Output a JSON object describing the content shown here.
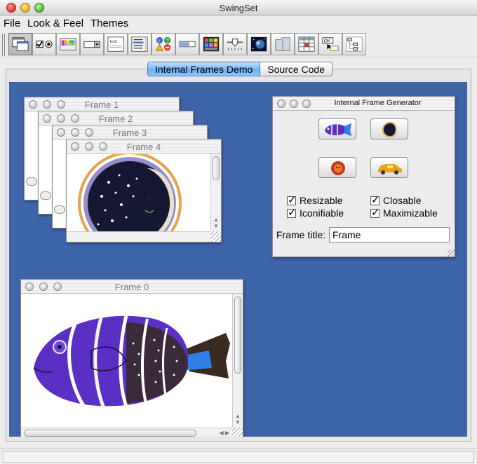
{
  "window": {
    "title": "SwingSet"
  },
  "menubar": {
    "items": [
      "File",
      "Look & Feel",
      "Themes"
    ]
  },
  "toolbar": {
    "buttons": [
      "internal-frames-icon",
      "checkbox-radio-icon",
      "color-chooser-icon",
      "combobox-icon",
      "editor-pane-icon",
      "list-icon",
      "option-pane-icon",
      "progress-bar-icon",
      "file-chooser-icon",
      "slider-icon",
      "scroll-pane-icon",
      "split-pane-icon",
      "table-icon",
      "tooltip-icon",
      "tree-icon"
    ],
    "tooltip_text": "OK"
  },
  "tabs": [
    "Internal Frames Demo",
    "Source Code"
  ],
  "frames": {
    "frame0": "Frame 0",
    "frame1": "Frame 1",
    "frame2": "Frame 2",
    "frame3": "Frame 3",
    "frame4": "Frame 4"
  },
  "generator": {
    "title": "Internal Frame Generator",
    "buttons": [
      "fish-icon",
      "moon-icon",
      "sun-icon",
      "car-icon"
    ],
    "checkboxes": [
      {
        "label": "Resizable",
        "checked": true
      },
      {
        "label": "Closable",
        "checked": true
      },
      {
        "label": "Iconifiable",
        "checked": true
      },
      {
        "label": "Maximizable",
        "checked": true
      }
    ],
    "frame_title_label": "Frame title:",
    "frame_title_value": "Frame"
  },
  "colors": {
    "desktop": "#3e65a8",
    "tab_active": "#69b0f4"
  }
}
